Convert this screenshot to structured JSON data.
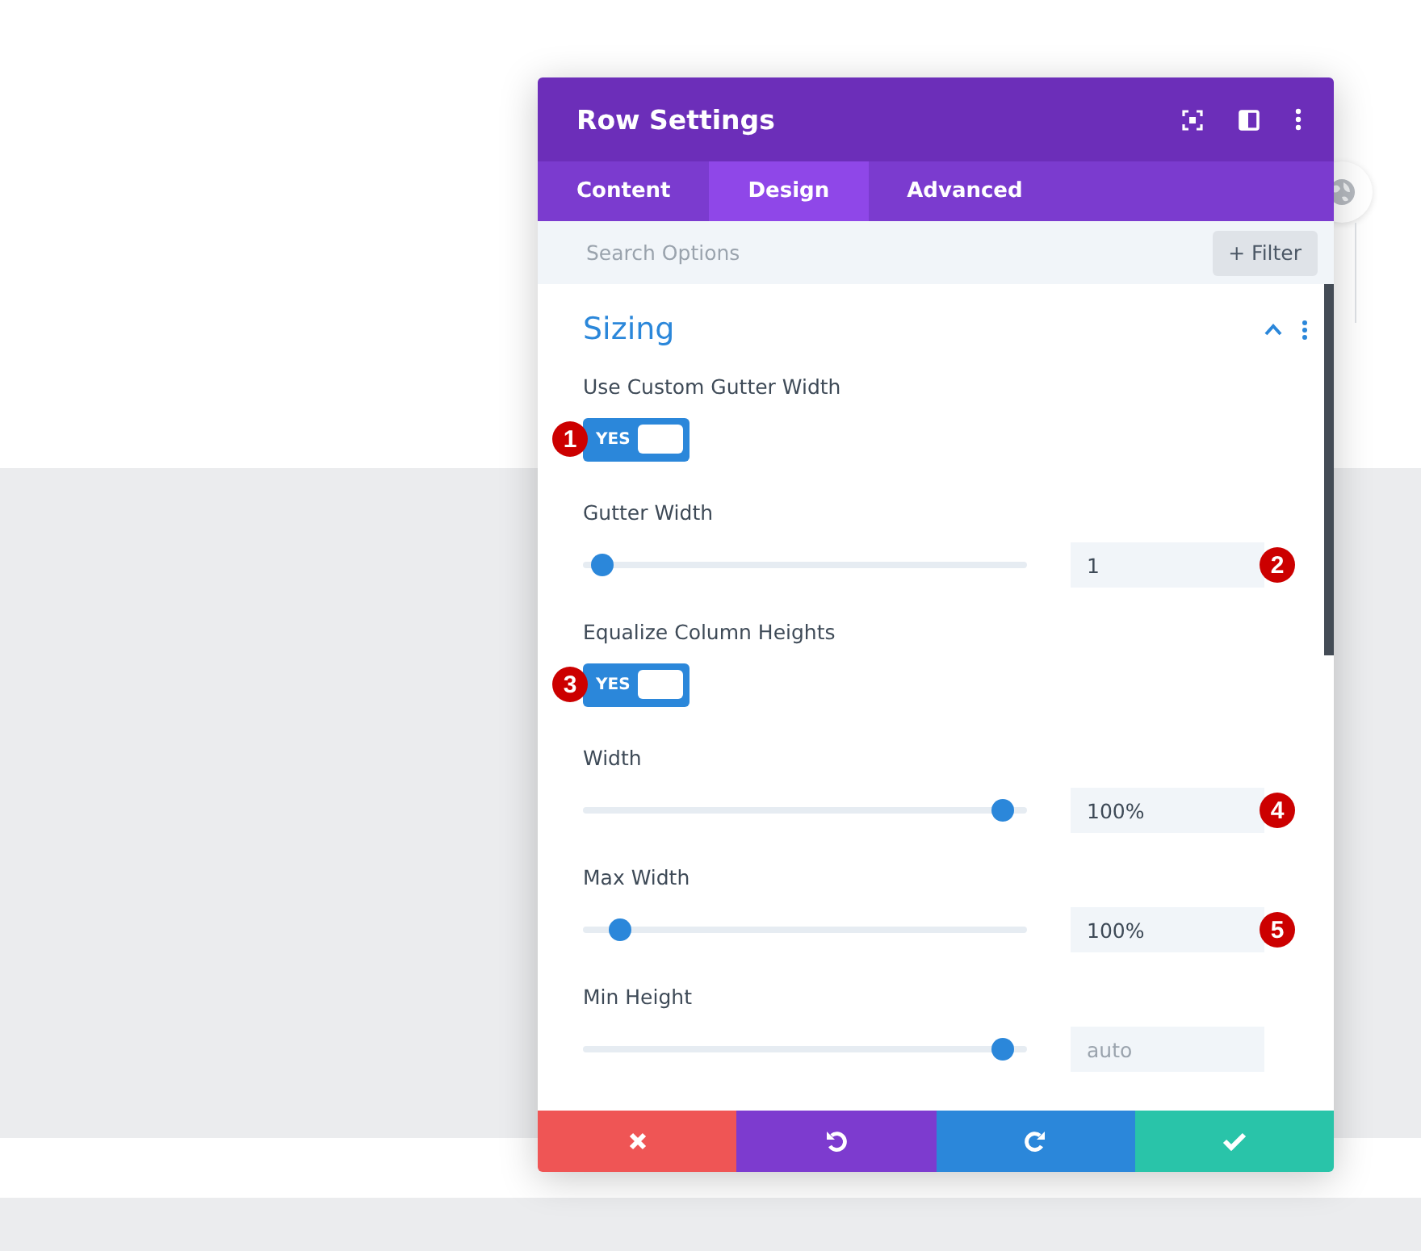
{
  "window": {
    "title": "Row Settings"
  },
  "tabs": [
    {
      "label": "Content",
      "selected": false
    },
    {
      "label": "Design",
      "selected": true
    },
    {
      "label": "Advanced",
      "selected": false
    }
  ],
  "search": {
    "placeholder": "Search Options",
    "filter_label": "Filter",
    "filter_icon": "+"
  },
  "section": {
    "title": "Sizing",
    "expanded": true
  },
  "settings": [
    {
      "kind": "toggle",
      "label": "Use Custom Gutter Width",
      "on": true,
      "toggle_text": "YES",
      "badge": "1"
    },
    {
      "kind": "slider",
      "label": "Gutter Width",
      "level": 0.02,
      "value": "1",
      "badge": "2"
    },
    {
      "kind": "toggle",
      "label": "Equalize Column Heights",
      "on": true,
      "toggle_text": "YES",
      "badge": "3"
    },
    {
      "kind": "slider",
      "label": "Width",
      "level": 0.97,
      "value": "100%",
      "badge": "4"
    },
    {
      "kind": "slider",
      "label": "Max Width",
      "level": 0.06,
      "value": "100%",
      "badge": "5"
    },
    {
      "kind": "slider",
      "label": "Min Height",
      "level": 0.97,
      "placeholder": "auto"
    }
  ],
  "footer": [
    {
      "kind": "cancel"
    },
    {
      "kind": "undo"
    },
    {
      "kind": "redo"
    },
    {
      "kind": "save"
    }
  ]
}
